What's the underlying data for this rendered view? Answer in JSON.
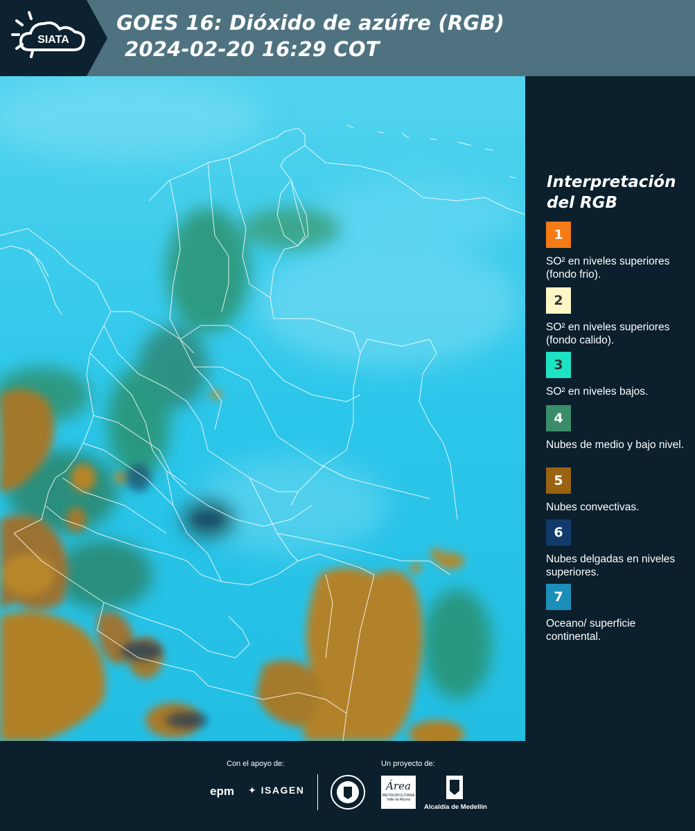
{
  "header": {
    "logo_text": "SIATA",
    "title_line1": "GOES 16: Dióxido de azúfre (RGB)",
    "title_line2": "2024-02-20 16:29 COT",
    "background": "#4f7280"
  },
  "map": {
    "land_color": "#2ec5e6",
    "cloud_color": "#b07c22",
    "lowcloud_color": "#2b8a5e",
    "border_color": "#ffffff"
  },
  "legend": {
    "title": "Interpretación del RGB",
    "items": [
      {
        "number": "1",
        "color": "#f47b16",
        "text_color": "#ffffff",
        "text": "SO² en niveles superiores (fondo frio)."
      },
      {
        "number": "2",
        "color": "#fff6c8",
        "text_color": "#333333",
        "text": "SO² en niveles superiores (fondo calido)."
      },
      {
        "number": "3",
        "color": "#1be3c4",
        "text_color": "#333333",
        "text": "SO² en niveles bajos."
      },
      {
        "number": "4",
        "color": "#3b8d6a",
        "text_color": "#ffffff",
        "text": "Nubes de medio y bajo nivel."
      },
      {
        "number": "5",
        "color": "#9a6312",
        "text_color": "#ffffff",
        "text": "Nubes convectivas."
      },
      {
        "number": "6",
        "color": "#123a6b",
        "text_color": "#ffffff",
        "text": "Nubes delgadas en niveles superiores."
      },
      {
        "number": "7",
        "color": "#1c8fb8",
        "text_color": "#ffffff",
        "text": "Oceano/ superficie continental."
      }
    ]
  },
  "footer": {
    "support_label": "Con el apoyo de:",
    "project_label": "Un proyecto de:",
    "sponsor1": "epm",
    "sponsor2": "ISAGEN",
    "partner_area": "Área",
    "partner_area_sub1": "METROPOLITANA",
    "partner_area_sub2": "Valle de Aburrá",
    "partner_alcaldia": "Alcaldía de Medellín"
  }
}
